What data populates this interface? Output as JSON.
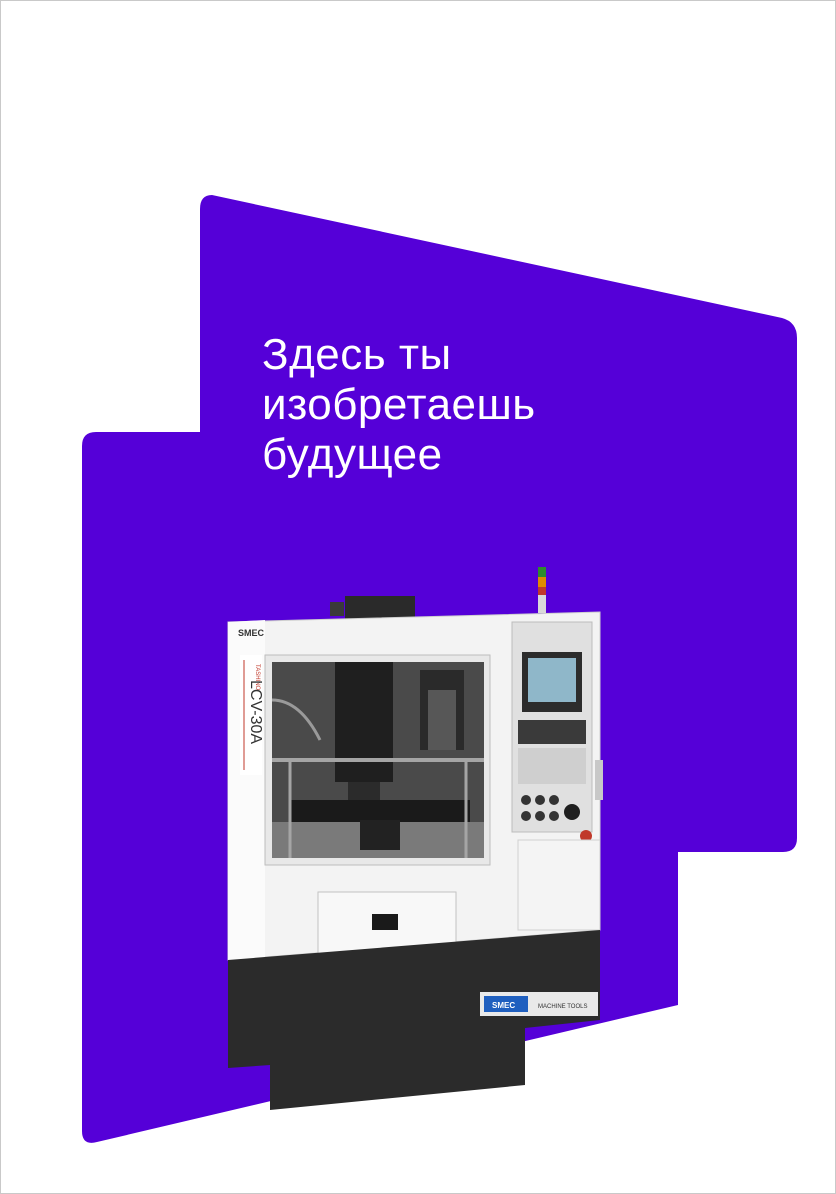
{
  "brand_color": "#5500d8",
  "headline": {
    "line1": "Здесь ты",
    "line2": "изобретаешь",
    "line3": "будущее"
  },
  "machine": {
    "maker_label": "SMEC",
    "series_label": "TASHINO",
    "model_label": "LCV-30A",
    "badge_left": "SMEC",
    "badge_right": "MACHINE TOOLS"
  }
}
